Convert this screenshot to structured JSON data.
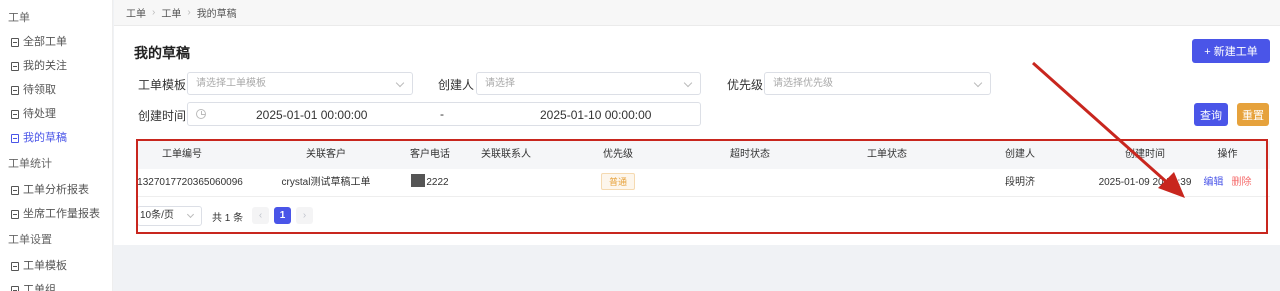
{
  "sidebar": {
    "groups": [
      {
        "label": "工单",
        "items": [
          "全部工单",
          "我的关注",
          "待领取",
          "待处理",
          "我的草稿"
        ]
      },
      {
        "label": "工单统计",
        "items": [
          "工单分析报表",
          "坐席工作量报表"
        ]
      },
      {
        "label": "工单设置",
        "items": [
          "工单模板",
          "工单组"
        ]
      }
    ],
    "active_item": "我的草稿"
  },
  "breadcrumb": [
    "工单",
    "工单",
    "我的草稿"
  ],
  "page": {
    "title": "我的草稿",
    "new_button": "+ 新建工单"
  },
  "filters": {
    "template": {
      "label": "工单模板",
      "placeholder": "请选择工单模板"
    },
    "creator": {
      "label": "创建人",
      "placeholder": "请选择"
    },
    "priority": {
      "label": "优先级",
      "placeholder": "请选择优先级"
    },
    "created_time": {
      "label": "创建时间",
      "start": "2025-01-01 00:00:00",
      "separator": "-",
      "end": "2025-01-10 00:00:00"
    },
    "query_button": "查询",
    "reset_button": "重置"
  },
  "table": {
    "columns": [
      "工单编号",
      "关联客户",
      "客户电话",
      "关联联系人",
      "优先级",
      "超时状态",
      "工单状态",
      "创建人",
      "创建时间",
      "操作"
    ],
    "rows": [
      {
        "id": "1327017720365060096",
        "customer": "crystal测试草稿工单",
        "phone": "2222",
        "contact": "",
        "priority": "普通",
        "timeout": "",
        "status": "",
        "creator": "段明济",
        "created": "2025-01-09 20:54:39",
        "actions": [
          "编辑",
          "删除"
        ]
      }
    ]
  },
  "pagination": {
    "page_size": "10条/页",
    "total": "共 1 条",
    "current_page": "1"
  },
  "colors": {
    "primary": "#4a55e8",
    "warning": "#e6a23c",
    "danger": "#f56c6c",
    "annotation": "#c8261e"
  }
}
